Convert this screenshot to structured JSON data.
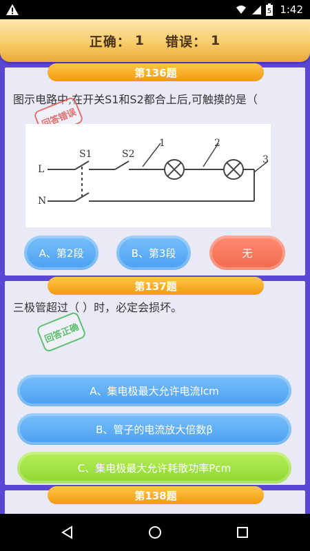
{
  "status": {
    "time": "1:42",
    "battery_text": "5"
  },
  "header": {
    "correct_label": "正确：",
    "correct_count": "1",
    "wrong_label": "错误：",
    "wrong_count": "1"
  },
  "questions": [
    {
      "number": "第136题",
      "text": "图示电路中,在开关S1和S2都合上后,可触摸的是（",
      "stamp": "回答错误",
      "diagram": {
        "label_L": "L",
        "label_N": "N",
        "label_S1": "S1",
        "label_S2": "S2",
        "label_1": "1",
        "label_2": "2",
        "label_3": "3"
      },
      "options": [
        "A、第2段",
        "B、第3段",
        "无"
      ]
    },
    {
      "number": "第137题",
      "text": "三极管超过（ ）时，必定会损坏。",
      "stamp": "回答正确",
      "options": [
        "A、集电极最大允许电流Icm",
        "B、管子的电流放大倍数β",
        "C、集电极最大允许耗散功率Pcm"
      ]
    },
    {
      "number": "第138题"
    }
  ]
}
